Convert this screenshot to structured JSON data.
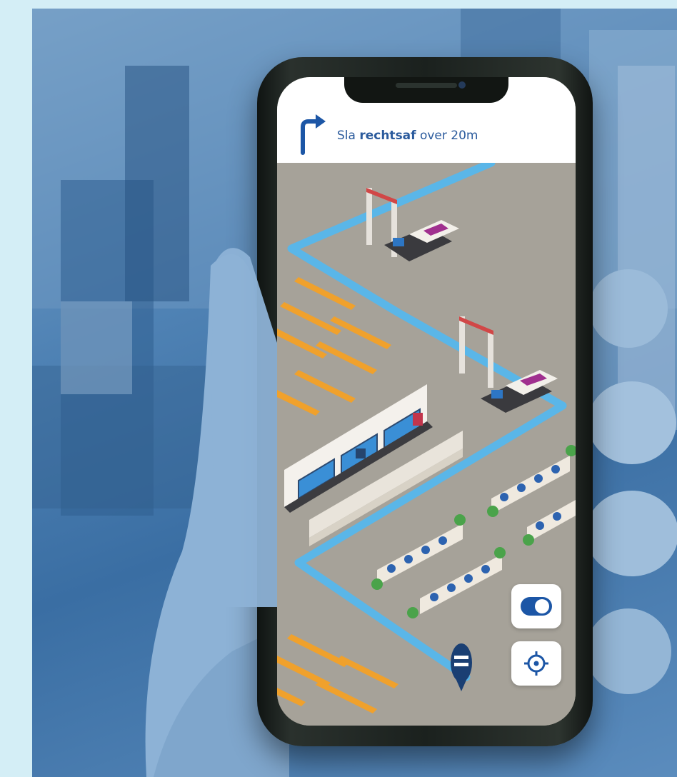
{
  "navigation": {
    "instruction_prefix": "Sla ",
    "instruction_bold": "rechtsaf",
    "instruction_suffix": " over 20m",
    "turn_icon": "turn-right-arrow-icon"
  },
  "map_controls": {
    "toggle": {
      "state": "on",
      "icon": "toggle-switch-icon"
    },
    "locate": {
      "icon": "crosshair-locate-icon"
    }
  },
  "colors": {
    "route": "#5ab6e8",
    "floor": "#a6a299",
    "accent": "#1c56a6",
    "benches": "#f0a12c",
    "instruction_text": "#2a5a9c"
  }
}
